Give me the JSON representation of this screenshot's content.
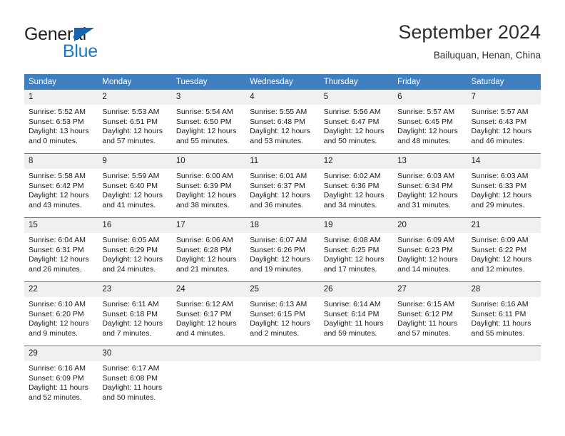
{
  "brand": {
    "word_one": "General",
    "word_two": "Blue",
    "triangle_icon": "brand-triangle-icon",
    "accent_dark": "#1565b0",
    "accent_light": "#1f7ac4"
  },
  "header": {
    "title": "September 2024",
    "subtitle": "Bailuquan, Henan, China"
  },
  "calendar": {
    "header_bg": "#3f7fbf",
    "daynum_bg": "#f0f0f0",
    "weekdays": [
      "Sunday",
      "Monday",
      "Tuesday",
      "Wednesday",
      "Thursday",
      "Friday",
      "Saturday"
    ],
    "weeks": [
      [
        {
          "day": "1",
          "sunrise": "Sunrise: 5:52 AM",
          "sunset": "Sunset: 6:53 PM",
          "daylight_line1": "Daylight: 13 hours",
          "daylight_line2": "and 0 minutes."
        },
        {
          "day": "2",
          "sunrise": "Sunrise: 5:53 AM",
          "sunset": "Sunset: 6:51 PM",
          "daylight_line1": "Daylight: 12 hours",
          "daylight_line2": "and 57 minutes."
        },
        {
          "day": "3",
          "sunrise": "Sunrise: 5:54 AM",
          "sunset": "Sunset: 6:50 PM",
          "daylight_line1": "Daylight: 12 hours",
          "daylight_line2": "and 55 minutes."
        },
        {
          "day": "4",
          "sunrise": "Sunrise: 5:55 AM",
          "sunset": "Sunset: 6:48 PM",
          "daylight_line1": "Daylight: 12 hours",
          "daylight_line2": "and 53 minutes."
        },
        {
          "day": "5",
          "sunrise": "Sunrise: 5:56 AM",
          "sunset": "Sunset: 6:47 PM",
          "daylight_line1": "Daylight: 12 hours",
          "daylight_line2": "and 50 minutes."
        },
        {
          "day": "6",
          "sunrise": "Sunrise: 5:57 AM",
          "sunset": "Sunset: 6:45 PM",
          "daylight_line1": "Daylight: 12 hours",
          "daylight_line2": "and 48 minutes."
        },
        {
          "day": "7",
          "sunrise": "Sunrise: 5:57 AM",
          "sunset": "Sunset: 6:43 PM",
          "daylight_line1": "Daylight: 12 hours",
          "daylight_line2": "and 46 minutes."
        }
      ],
      [
        {
          "day": "8",
          "sunrise": "Sunrise: 5:58 AM",
          "sunset": "Sunset: 6:42 PM",
          "daylight_line1": "Daylight: 12 hours",
          "daylight_line2": "and 43 minutes."
        },
        {
          "day": "9",
          "sunrise": "Sunrise: 5:59 AM",
          "sunset": "Sunset: 6:40 PM",
          "daylight_line1": "Daylight: 12 hours",
          "daylight_line2": "and 41 minutes."
        },
        {
          "day": "10",
          "sunrise": "Sunrise: 6:00 AM",
          "sunset": "Sunset: 6:39 PM",
          "daylight_line1": "Daylight: 12 hours",
          "daylight_line2": "and 38 minutes."
        },
        {
          "day": "11",
          "sunrise": "Sunrise: 6:01 AM",
          "sunset": "Sunset: 6:37 PM",
          "daylight_line1": "Daylight: 12 hours",
          "daylight_line2": "and 36 minutes."
        },
        {
          "day": "12",
          "sunrise": "Sunrise: 6:02 AM",
          "sunset": "Sunset: 6:36 PM",
          "daylight_line1": "Daylight: 12 hours",
          "daylight_line2": "and 34 minutes."
        },
        {
          "day": "13",
          "sunrise": "Sunrise: 6:03 AM",
          "sunset": "Sunset: 6:34 PM",
          "daylight_line1": "Daylight: 12 hours",
          "daylight_line2": "and 31 minutes."
        },
        {
          "day": "14",
          "sunrise": "Sunrise: 6:03 AM",
          "sunset": "Sunset: 6:33 PM",
          "daylight_line1": "Daylight: 12 hours",
          "daylight_line2": "and 29 minutes."
        }
      ],
      [
        {
          "day": "15",
          "sunrise": "Sunrise: 6:04 AM",
          "sunset": "Sunset: 6:31 PM",
          "daylight_line1": "Daylight: 12 hours",
          "daylight_line2": "and 26 minutes."
        },
        {
          "day": "16",
          "sunrise": "Sunrise: 6:05 AM",
          "sunset": "Sunset: 6:29 PM",
          "daylight_line1": "Daylight: 12 hours",
          "daylight_line2": "and 24 minutes."
        },
        {
          "day": "17",
          "sunrise": "Sunrise: 6:06 AM",
          "sunset": "Sunset: 6:28 PM",
          "daylight_line1": "Daylight: 12 hours",
          "daylight_line2": "and 21 minutes."
        },
        {
          "day": "18",
          "sunrise": "Sunrise: 6:07 AM",
          "sunset": "Sunset: 6:26 PM",
          "daylight_line1": "Daylight: 12 hours",
          "daylight_line2": "and 19 minutes."
        },
        {
          "day": "19",
          "sunrise": "Sunrise: 6:08 AM",
          "sunset": "Sunset: 6:25 PM",
          "daylight_line1": "Daylight: 12 hours",
          "daylight_line2": "and 17 minutes."
        },
        {
          "day": "20",
          "sunrise": "Sunrise: 6:09 AM",
          "sunset": "Sunset: 6:23 PM",
          "daylight_line1": "Daylight: 12 hours",
          "daylight_line2": "and 14 minutes."
        },
        {
          "day": "21",
          "sunrise": "Sunrise: 6:09 AM",
          "sunset": "Sunset: 6:22 PM",
          "daylight_line1": "Daylight: 12 hours",
          "daylight_line2": "and 12 minutes."
        }
      ],
      [
        {
          "day": "22",
          "sunrise": "Sunrise: 6:10 AM",
          "sunset": "Sunset: 6:20 PM",
          "daylight_line1": "Daylight: 12 hours",
          "daylight_line2": "and 9 minutes."
        },
        {
          "day": "23",
          "sunrise": "Sunrise: 6:11 AM",
          "sunset": "Sunset: 6:18 PM",
          "daylight_line1": "Daylight: 12 hours",
          "daylight_line2": "and 7 minutes."
        },
        {
          "day": "24",
          "sunrise": "Sunrise: 6:12 AM",
          "sunset": "Sunset: 6:17 PM",
          "daylight_line1": "Daylight: 12 hours",
          "daylight_line2": "and 4 minutes."
        },
        {
          "day": "25",
          "sunrise": "Sunrise: 6:13 AM",
          "sunset": "Sunset: 6:15 PM",
          "daylight_line1": "Daylight: 12 hours",
          "daylight_line2": "and 2 minutes."
        },
        {
          "day": "26",
          "sunrise": "Sunrise: 6:14 AM",
          "sunset": "Sunset: 6:14 PM",
          "daylight_line1": "Daylight: 11 hours",
          "daylight_line2": "and 59 minutes."
        },
        {
          "day": "27",
          "sunrise": "Sunrise: 6:15 AM",
          "sunset": "Sunset: 6:12 PM",
          "daylight_line1": "Daylight: 11 hours",
          "daylight_line2": "and 57 minutes."
        },
        {
          "day": "28",
          "sunrise": "Sunrise: 6:16 AM",
          "sunset": "Sunset: 6:11 PM",
          "daylight_line1": "Daylight: 11 hours",
          "daylight_line2": "and 55 minutes."
        }
      ],
      [
        {
          "day": "29",
          "sunrise": "Sunrise: 6:16 AM",
          "sunset": "Sunset: 6:09 PM",
          "daylight_line1": "Daylight: 11 hours",
          "daylight_line2": "and 52 minutes."
        },
        {
          "day": "30",
          "sunrise": "Sunrise: 6:17 AM",
          "sunset": "Sunset: 6:08 PM",
          "daylight_line1": "Daylight: 11 hours",
          "daylight_line2": "and 50 minutes."
        },
        {
          "day": "",
          "sunrise": "",
          "sunset": "",
          "daylight_line1": "",
          "daylight_line2": ""
        },
        {
          "day": "",
          "sunrise": "",
          "sunset": "",
          "daylight_line1": "",
          "daylight_line2": ""
        },
        {
          "day": "",
          "sunrise": "",
          "sunset": "",
          "daylight_line1": "",
          "daylight_line2": ""
        },
        {
          "day": "",
          "sunrise": "",
          "sunset": "",
          "daylight_line1": "",
          "daylight_line2": ""
        },
        {
          "day": "",
          "sunrise": "",
          "sunset": "",
          "daylight_line1": "",
          "daylight_line2": ""
        }
      ]
    ]
  }
}
